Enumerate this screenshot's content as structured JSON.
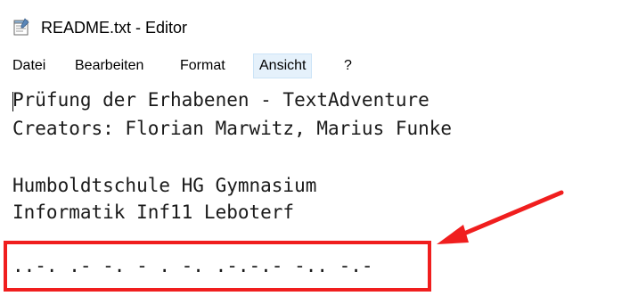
{
  "window": {
    "title": "README.txt - Editor",
    "icon": "notepad-icon"
  },
  "menu": {
    "items": [
      {
        "label": "Datei"
      },
      {
        "label": "Bearbeiten"
      },
      {
        "label": "Format"
      },
      {
        "label": "Ansicht",
        "active": true
      },
      {
        "label": "?"
      }
    ]
  },
  "editor": {
    "lines": [
      "Prüfung der Erhabenen - TextAdventure",
      "Creators: Florian Marwitz, Marius Funke",
      "",
      "Humboldtschule HG Gymnasium",
      "Informatik Inf11 Leboterf",
      "",
      "..-. .- -. - . -. .-.-.- -.. -.-"
    ]
  },
  "annotation": {
    "color": "#f01e1e",
    "target": "morse-code-line"
  },
  "colors": {
    "menu_active_bg": "#e5f1fb",
    "menu_active_border": "#cce4f7",
    "annotation": "#f01e1e"
  }
}
